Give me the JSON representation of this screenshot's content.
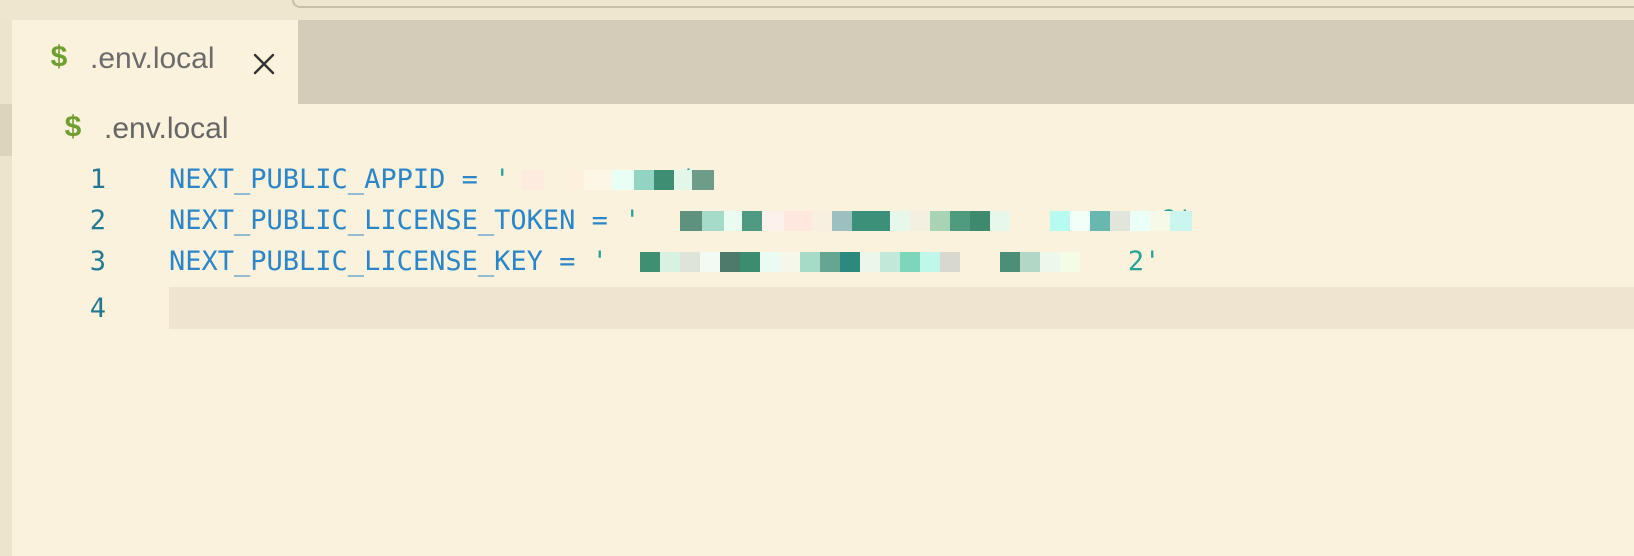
{
  "tab": {
    "icon": "$",
    "label": ".env.local",
    "close_icon": "close-icon"
  },
  "breadcrumb": {
    "icon": "$",
    "label": ".env.local"
  },
  "lines": [
    {
      "number": "1",
      "key": "NEXT_PUBLIC_APPID",
      "op": " = ",
      "open": "'",
      "close": "'"
    },
    {
      "number": "2",
      "key": "NEXT_PUBLIC_LICENSE_TOKEN",
      "op": " = ",
      "open": "'",
      "close": "8'"
    },
    {
      "number": "3",
      "key": "NEXT_PUBLIC_LICENSE_KEY",
      "op": " = ",
      "open": "'",
      "close": "2'"
    },
    {
      "number": "4"
    }
  ],
  "colors": {
    "background": "#fbf2dd",
    "tabbar": "#d4cbb8",
    "line_number": "#237893",
    "variable": "#2a86c8",
    "string": "#2aa198",
    "shell_icon": "#6e9f2f",
    "current_line": "#eee4cf"
  }
}
